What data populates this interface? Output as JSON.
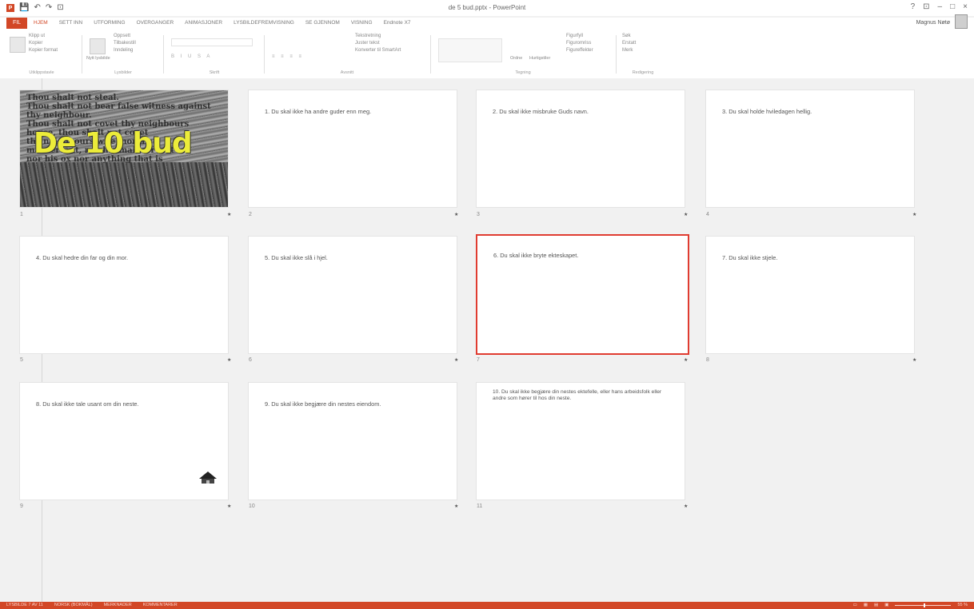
{
  "window": {
    "title": "de 5 bud.pptx - PowerPoint",
    "user": "Magnus Nøtø",
    "controls": [
      "?",
      "⊡",
      "–",
      "□",
      "×"
    ]
  },
  "qat": {
    "app": "P",
    "save": "💾",
    "undo": "↶",
    "redo": "↷",
    "more": "⊡"
  },
  "tabs": {
    "file": "FIL",
    "items": [
      "HJEM",
      "SETT INN",
      "UTFORMING",
      "OVERGANGER",
      "ANIMASJONER",
      "LYSBILDEFREMVISNING",
      "SE GJENNOM",
      "VISNING",
      "Endnote X7"
    ]
  },
  "ribbon": {
    "clipboard": {
      "cut": "Klipp ut",
      "copy": "Kopier",
      "paint": "Kopier format",
      "label": "Utklippstavle"
    },
    "slides": {
      "new": "Nytt lysbilde",
      "layout": "Oppsett",
      "reset": "Tilbakestill",
      "section": "Inndeling",
      "label": "Lysbilder"
    },
    "font": {
      "label": "Skrift"
    },
    "paragraph": {
      "dir": "Tekstretning",
      "align": "Juster tekst",
      "smart": "Konverter til SmartArt",
      "label": "Avsnitt"
    },
    "drawing": {
      "arrange": "Ordne",
      "styles": "Hurtigstiler",
      "fill": "Figurfyll",
      "outline": "Figuromriss",
      "effects": "Figureffekter",
      "label": "Tegning"
    },
    "editing": {
      "find": "Søk",
      "replace": "Erstatt",
      "select": "Merk",
      "label": "Redigering"
    }
  },
  "title_slide": {
    "heading": "De 10 bud",
    "bg_lines": [
      "Thou shalt not steal.",
      "Thou shalt not bear false witness against",
      "thy neighbour.",
      "Thou shalt not covet thy neighbours",
      "house, thou shalt not covet",
      "thy neighbours wife, nor his",
      "manservant, nor his maidservant",
      "nor his ox nor anything that is"
    ]
  },
  "slides": [
    {
      "num": "1",
      "text": "",
      "star": "★"
    },
    {
      "num": "2",
      "text": "1. Du skal ikke ha andre guder enn meg.",
      "star": "★"
    },
    {
      "num": "3",
      "text": "2. Du skal ikke misbruke Guds navn.",
      "star": "★"
    },
    {
      "num": "4",
      "text": "3. Du skal holde hviledagen hellig.",
      "star": "★"
    },
    {
      "num": "5",
      "text": "4. Du skal hedre din far og din mor.",
      "star": "★"
    },
    {
      "num": "6",
      "text": "5. Du skal ikke slå i hjel.",
      "star": "★"
    },
    {
      "num": "7",
      "text": "6. Du skal ikke bryte ekteskapet.",
      "star": "★"
    },
    {
      "num": "8",
      "text": "7. Du skal ikke stjele.",
      "star": "★"
    },
    {
      "num": "9",
      "text": "8. Du skal ikke tale usant om din neste.",
      "star": "★"
    },
    {
      "num": "10",
      "text": "9. Du skal ikke begjære din nestes eiendom.",
      "star": "★"
    },
    {
      "num": "11",
      "text": "10. Du skal ikke begjære din nestes ektefelle, eller hans arbeidsfolk eller andre som hører til hos din neste.",
      "star": "★"
    }
  ],
  "statusbar": {
    "slide": "LYSBILDE 7 AV 11",
    "lang": "NORSK (BOKMÅL)",
    "notes": "MERKNADER",
    "comments": "KOMMENTARER",
    "zoom": "55 %"
  },
  "colors": {
    "accent": "#d24726",
    "selected": "#e03c31",
    "title_yellow": "#ecec3a"
  }
}
